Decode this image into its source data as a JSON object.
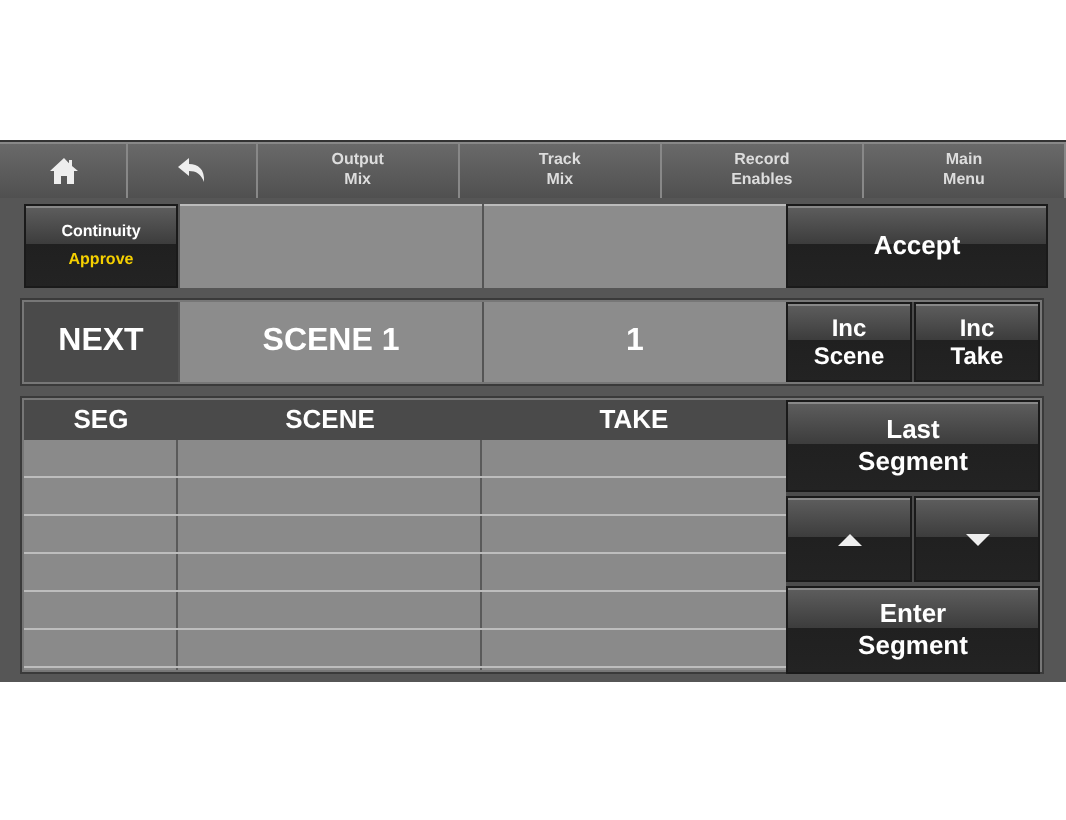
{
  "toolbar": [
    {
      "kind": "home"
    },
    {
      "kind": "back"
    },
    {
      "kind": "text",
      "label": "Output\nMix"
    },
    {
      "kind": "text",
      "label": "Track\nMix"
    },
    {
      "kind": "text",
      "label": "Record\nEnables"
    },
    {
      "kind": "text",
      "label": "Main\nMenu"
    }
  ],
  "approval": {
    "label": "Continuity",
    "status": "Approve"
  },
  "accept_button": "Accept",
  "next": {
    "label": "NEXT",
    "scene": "SCENE 1",
    "take": "1"
  },
  "inc_buttons": [
    "Inc\nScene",
    "Inc\nTake"
  ],
  "table": {
    "columns": [
      "SEG",
      "SCENE",
      "TAKE"
    ]
  },
  "side_buttons": [
    {
      "kind": "text",
      "label": "Last\nSegment"
    },
    {
      "kind": "arrows"
    },
    {
      "kind": "text",
      "label": "Enter\nSegment"
    }
  ]
}
